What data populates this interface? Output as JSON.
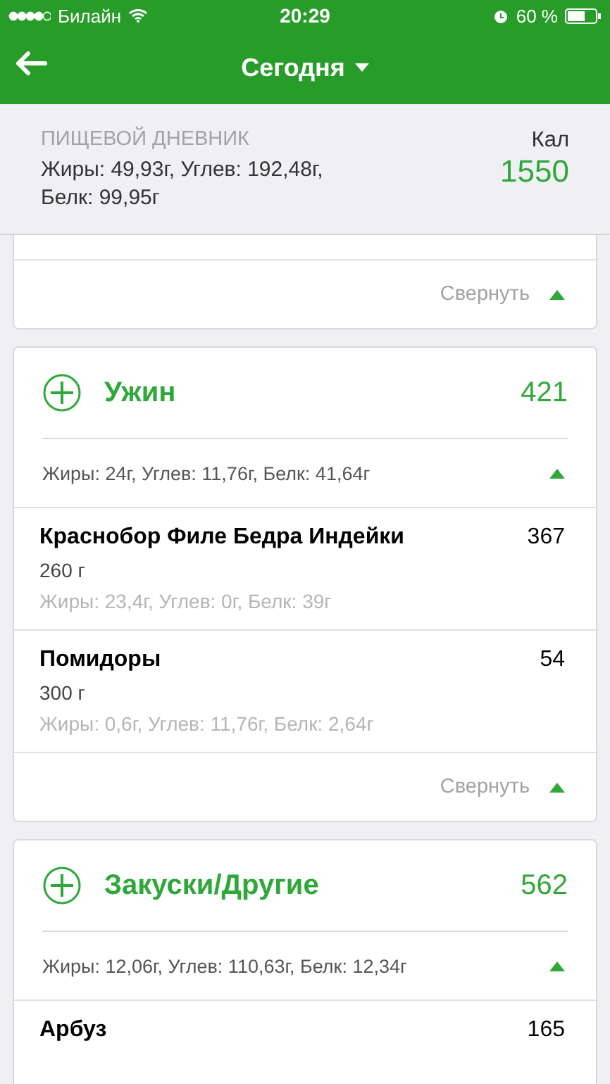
{
  "status_bar": {
    "carrier": "Билайн",
    "time": "20:29",
    "battery": "60 %"
  },
  "header": {
    "title": "Сегодня"
  },
  "summary": {
    "label": "ПИЩЕВОЙ ДНЕВНИК",
    "macros": "Жиры: 49,93г, Углев: 192,48г, Белк: 99,95г",
    "kcal_label": "Кал",
    "kcal": "1550"
  },
  "meals": [
    {
      "kind": "tail",
      "collapse_label": "Свернуть"
    },
    {
      "kind": "meal",
      "name": "Ужин",
      "calories": "421",
      "macros": "Жиры: 24г, Углев: 11,76г, Белк: 41,64г",
      "expanded": true,
      "collapse_label": "Свернуть",
      "items": [
        {
          "name": "Краснобор Филе Бедра Индейки",
          "calories": "367",
          "weight": "260 г",
          "macros": "Жиры: 23,4г, Углев: 0г, Белк: 39г"
        },
        {
          "name": "Помидоры",
          "calories": "54",
          "weight": "300 г",
          "macros": "Жиры: 0,6г, Углев: 11,76г, Белк: 2,64г"
        }
      ]
    },
    {
      "kind": "meal",
      "name": "Закуски/Другие",
      "calories": "562",
      "macros": "Жиры: 12,06г, Углев: 110,63г, Белк: 12,34г",
      "expanded": true,
      "items": [
        {
          "name": "Арбуз",
          "calories": "165"
        }
      ]
    }
  ]
}
